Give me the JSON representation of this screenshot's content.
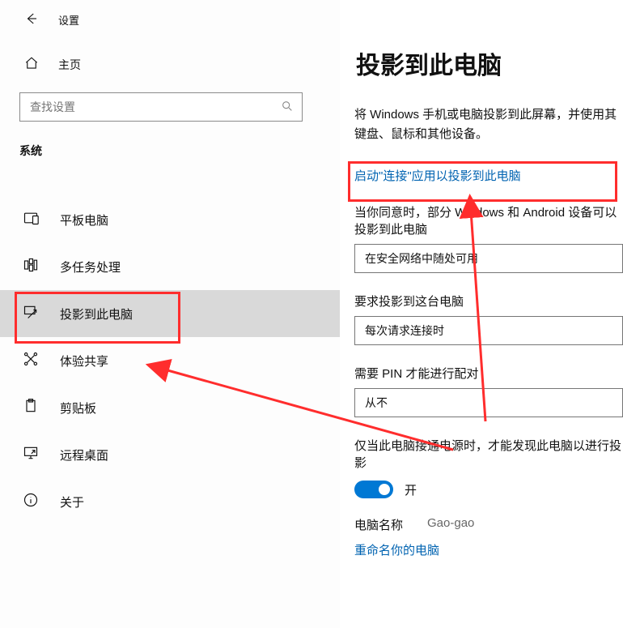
{
  "header": {
    "title": "设置",
    "home_label": "主页"
  },
  "search": {
    "placeholder": "查找设置"
  },
  "section_label": "系统",
  "sidebar": {
    "items": [
      {
        "label": "平板电脑"
      },
      {
        "label": "多任务处理"
      },
      {
        "label": "投影到此电脑"
      },
      {
        "label": "体验共享"
      },
      {
        "label": "剪贴板"
      },
      {
        "label": "远程桌面"
      },
      {
        "label": "关于"
      }
    ]
  },
  "page": {
    "title": "投影到此电脑",
    "desc": "将 Windows 手机或电脑投影到此屏幕，并使用其键盘、鼠标和其他设备。",
    "launch_link": "启动\"连接\"应用以投影到此电脑",
    "opt1_label": "当你同意时，部分 Windows 和 Android 设备可以投影到此电脑",
    "opt1_value": "在安全网络中随处可用",
    "opt2_label": "要求投影到这台电脑",
    "opt2_value": "每次请求连接时",
    "opt3_label": "需要 PIN 才能进行配对",
    "opt3_value": "从不",
    "power_label": "仅当此电脑接通电源时，才能发现此电脑以进行投影",
    "toggle_state": "开",
    "pcname_label": "电脑名称",
    "pcname_value": "Gao-gao",
    "rename_link": "重命名你的电脑"
  }
}
